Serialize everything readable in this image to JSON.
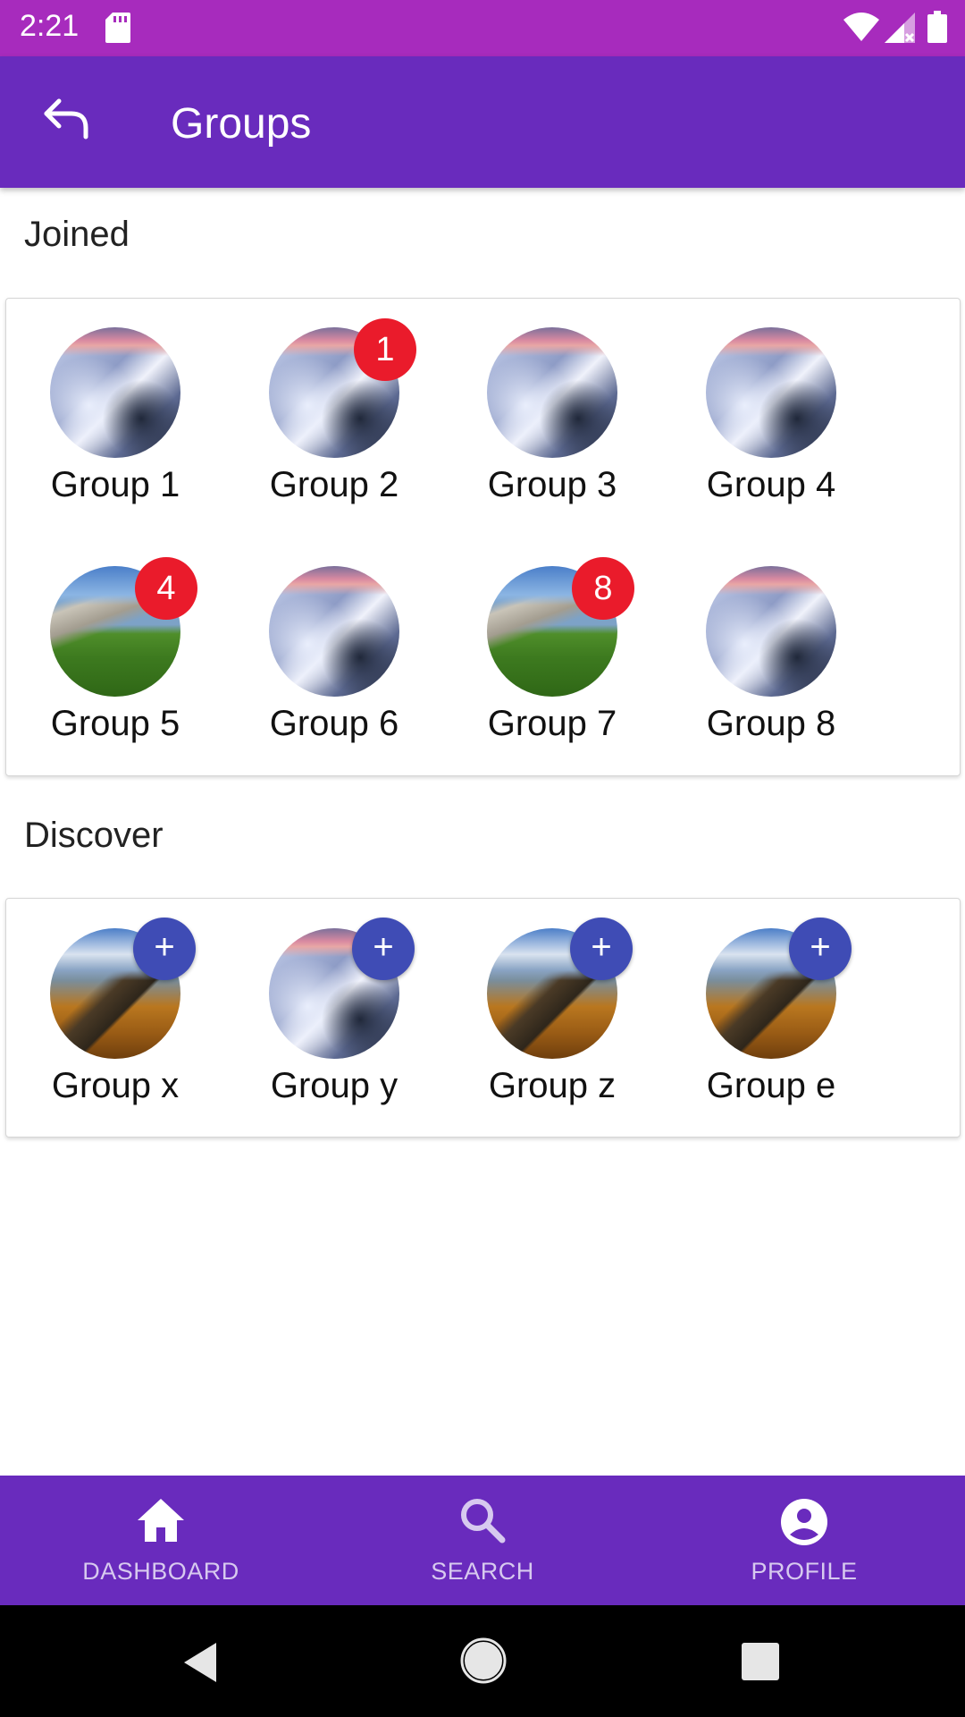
{
  "status_bar": {
    "time": "2:21"
  },
  "app_bar": {
    "title": "Groups"
  },
  "joined": {
    "title": "Joined",
    "groups": [
      {
        "label": "Group 1",
        "image": "snow",
        "badge": ""
      },
      {
        "label": "Group 2",
        "image": "snow",
        "badge": "1"
      },
      {
        "label": "Group 3",
        "image": "snow",
        "badge": ""
      },
      {
        "label": "Group 4",
        "image": "snow",
        "badge": ""
      },
      {
        "label": "Group 5",
        "image": "valley",
        "badge": "4"
      },
      {
        "label": "Group 6",
        "image": "snow",
        "badge": ""
      },
      {
        "label": "Group 7",
        "image": "valley",
        "badge": "8"
      },
      {
        "label": "Group 8",
        "image": "snow",
        "badge": ""
      }
    ]
  },
  "discover": {
    "title": "Discover",
    "join_symbol": "+",
    "groups": [
      {
        "label": "Group x",
        "image": "mountain"
      },
      {
        "label": "Group y",
        "image": "snow"
      },
      {
        "label": "Group z",
        "image": "mountain"
      },
      {
        "label": "Group e",
        "image": "mountain"
      }
    ]
  },
  "bottom_nav": {
    "items": [
      {
        "label": "DASHBOARD",
        "icon": "home-icon"
      },
      {
        "label": "SEARCH",
        "icon": "search-icon"
      },
      {
        "label": "PROFILE",
        "icon": "account-circle-icon"
      }
    ]
  },
  "colors": {
    "status_bar": "#a72bbd",
    "app_bar": "#692bbd",
    "badge": "#ea1b2b",
    "join_button": "#3f4cb5"
  }
}
